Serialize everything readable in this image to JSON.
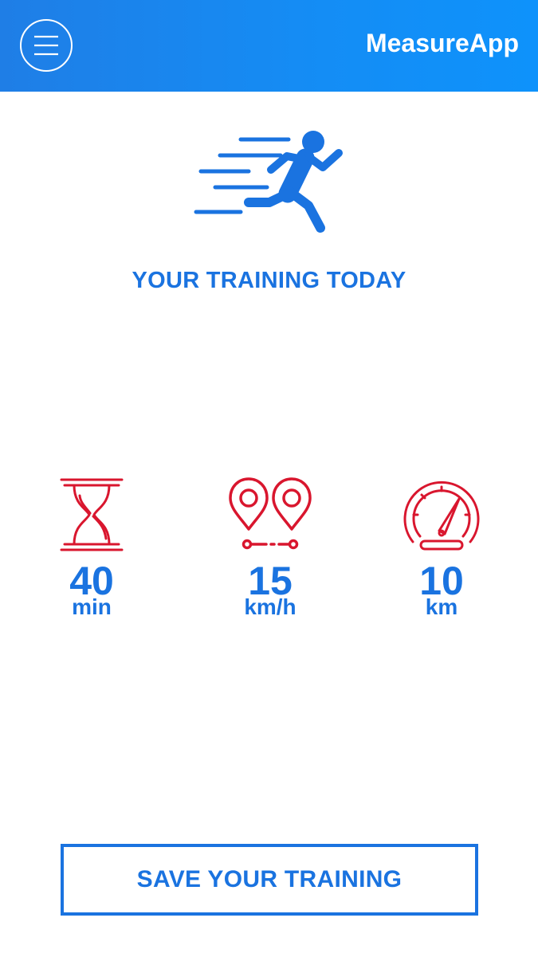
{
  "header": {
    "title": "MeasureApp",
    "menu_icon": "hamburger-menu-icon"
  },
  "hero": {
    "icon": "running-person-icon",
    "title": "YOUR TRAINING TODAY"
  },
  "stats": [
    {
      "icon": "hourglass-icon",
      "value": "40",
      "unit": "min"
    },
    {
      "icon": "route-pins-icon",
      "value": "15",
      "unit": "km/h"
    },
    {
      "icon": "speedometer-icon",
      "value": "10",
      "unit": "km"
    }
  ],
  "actions": {
    "save_label": "SAVE YOUR TRAINING"
  },
  "colors": {
    "primary_blue": "#1a73e0",
    "header_gradient_start": "#1f7ee6",
    "header_gradient_end": "#0e92fb",
    "icon_red": "#d9162e",
    "background": "#ffffff"
  }
}
